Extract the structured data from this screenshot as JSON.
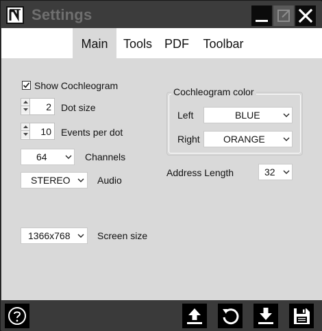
{
  "window": {
    "title": "Settings"
  },
  "tabs": [
    {
      "label": "Main",
      "active": true
    },
    {
      "label": "Tools",
      "active": false
    },
    {
      "label": "PDF",
      "active": false
    },
    {
      "label": "Toolbar",
      "active": false
    }
  ],
  "main": {
    "show_cochleogram": {
      "label": "Show Cochleogram",
      "checked": true
    },
    "dot_size": {
      "value": "2",
      "label": "Dot size"
    },
    "events_per_dot": {
      "value": "10",
      "label": "Events per dot"
    },
    "channels": {
      "value": "64",
      "label": "Channels"
    },
    "audio": {
      "value": "STEREO",
      "label": "Audio"
    },
    "screen_size": {
      "value": "1366x768",
      "label": "Screen size"
    },
    "cochleogram_color": {
      "title": "Cochleogram color",
      "left": {
        "label": "Left",
        "value": "BLUE"
      },
      "right": {
        "label": "Right",
        "value": "ORANGE"
      }
    },
    "address_length": {
      "label": "Address Length",
      "value": "32"
    }
  },
  "bottom_bar": {
    "icons": [
      "help-icon",
      "upload-icon",
      "reset-icon",
      "download-icon",
      "save-icon"
    ]
  },
  "colors": {
    "titlebar": "#3c3c3c",
    "content_bg": "#d9d9d9",
    "active_tab_bg": "#d9d9d9",
    "button_bg": "#000000"
  }
}
